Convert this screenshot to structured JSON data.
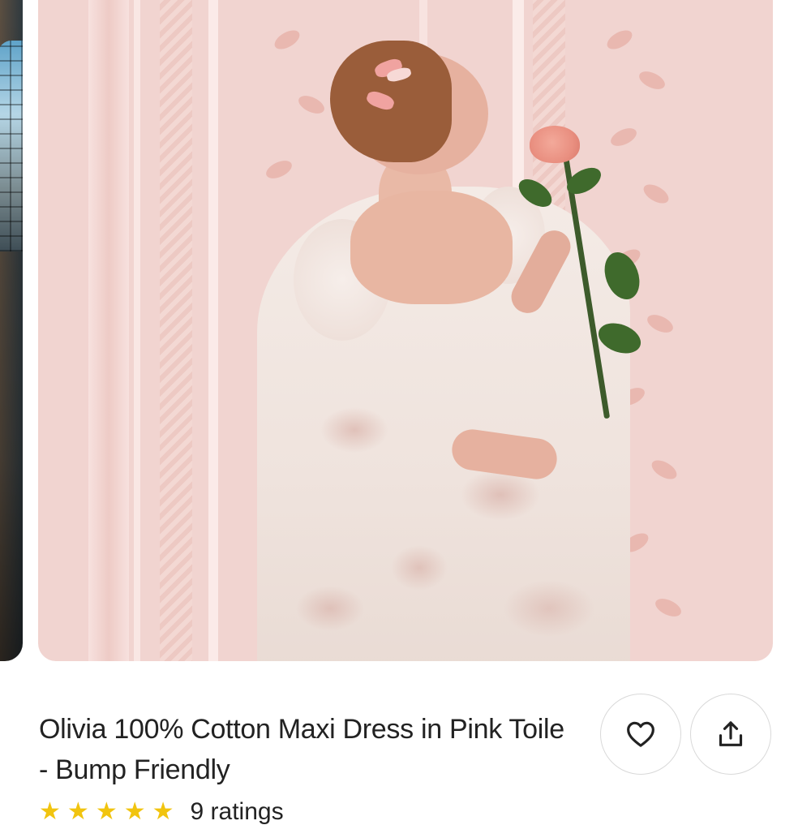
{
  "listing": {
    "title": "Olivia 100% Cotton Maxi Dress in Pink Toile - Bump Friendly",
    "rating_count_text": "9 ratings",
    "star_count": 5
  },
  "gallery": {
    "main_image_icon": "photo-woman-pink-toile-dress-with-rose",
    "prev_image_icon": "photo-interior-window"
  },
  "actions": {
    "favorite_icon": "heart-icon",
    "share_icon": "share-icon"
  },
  "colors": {
    "text": "#222222",
    "star": "#f1c40f",
    "button_border": "#d9d9d9"
  }
}
